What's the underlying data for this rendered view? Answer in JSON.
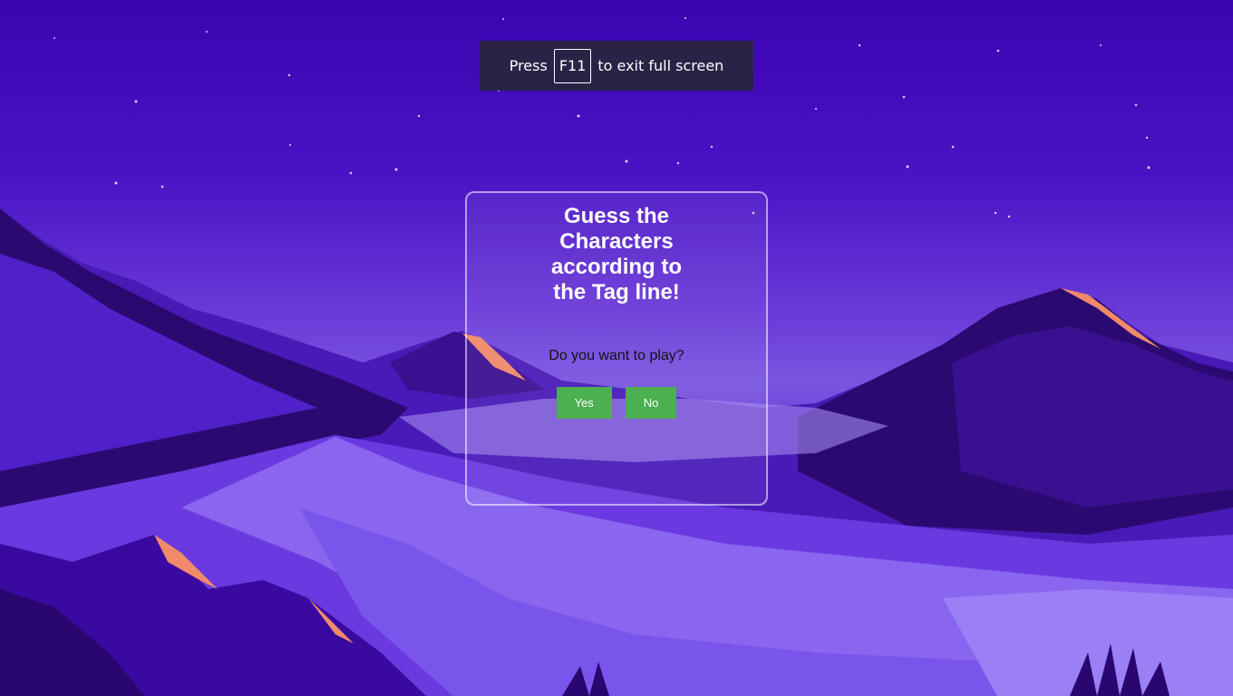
{
  "fullscreen_hint": {
    "prefix": "Press",
    "key": "F11",
    "suffix": "to exit full screen"
  },
  "game": {
    "title": "Guess the Characters according to the Tag line!",
    "question": "Do you want to play?",
    "yes_label": "Yes",
    "no_label": "No"
  },
  "colors": {
    "sky": "#3a05b0",
    "button": "#4caf50",
    "banner": "#2a2346"
  }
}
